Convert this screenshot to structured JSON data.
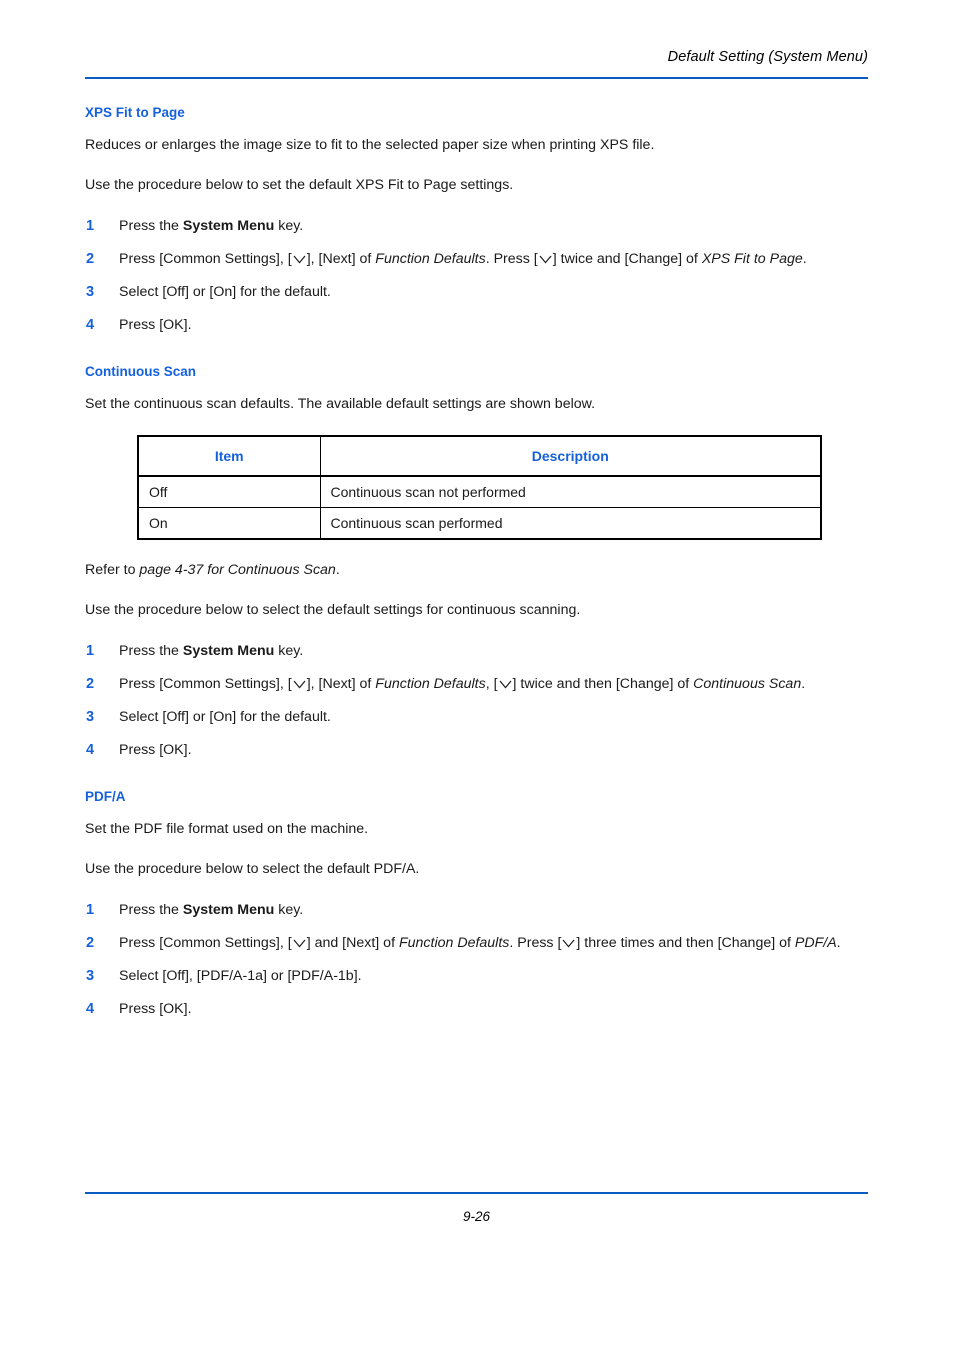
{
  "header": {
    "title": "Default Setting (System Menu)"
  },
  "footer": {
    "page_number": "9-26"
  },
  "colors": {
    "heading_blue": "#1560dd",
    "rule_blue": "#0b5cc0",
    "step_number_blue": "#1560dd",
    "table_header_blue": "#1560dd",
    "body_text": "#1a1a1a",
    "table_border": "#000000"
  },
  "sections": [
    {
      "heading": "XPS Fit to Page",
      "intro_1": "Reduces or enlarges the image size to fit to the selected paper size when printing XPS file.",
      "intro_2": "Use the procedure below to set the default XPS Fit to Page settings.",
      "steps": [
        {
          "num": "1",
          "parts": [
            {
              "t": "text",
              "v": "Press the "
            },
            {
              "t": "bold",
              "v": "System Menu"
            },
            {
              "t": "text",
              "v": " key."
            }
          ]
        },
        {
          "num": "2",
          "parts": [
            {
              "t": "text",
              "v": "Press [Common Settings], ["
            },
            {
              "t": "chevron",
              "v": "down-chevron"
            },
            {
              "t": "text",
              "v": "], [Next] of "
            },
            {
              "t": "italic",
              "v": "Function Defaults"
            },
            {
              "t": "text",
              "v": ". Press ["
            },
            {
              "t": "chevron",
              "v": "down-chevron"
            },
            {
              "t": "text",
              "v": "] twice and [Change] of "
            },
            {
              "t": "italic",
              "v": "XPS Fit to Page"
            },
            {
              "t": "text",
              "v": "."
            }
          ]
        },
        {
          "num": "3",
          "parts": [
            {
              "t": "text",
              "v": "Select [Off] or [On] for the default."
            }
          ]
        },
        {
          "num": "4",
          "parts": [
            {
              "t": "text",
              "v": "Press [OK]."
            }
          ]
        }
      ]
    },
    {
      "heading": "Continuous Scan",
      "intro_1": "Set the continuous scan defaults. The available default settings are shown below.",
      "table": {
        "columns": [
          "Item",
          "Description"
        ],
        "rows": [
          [
            "Off",
            "Continuous scan not performed"
          ],
          [
            "On",
            "Continuous scan performed"
          ]
        ]
      },
      "refer_to": [
        {
          "t": "text",
          "v": "Refer to "
        },
        {
          "t": "italic",
          "v": "page 4-37 for Continuous Scan"
        },
        {
          "t": "text",
          "v": "."
        }
      ],
      "intro_2": "Use the procedure below to select the default settings for continuous scanning.",
      "steps": [
        {
          "num": "1",
          "parts": [
            {
              "t": "text",
              "v": "Press the "
            },
            {
              "t": "bold",
              "v": "System Menu"
            },
            {
              "t": "text",
              "v": " key."
            }
          ]
        },
        {
          "num": "2",
          "parts": [
            {
              "t": "text",
              "v": "Press [Common Settings], ["
            },
            {
              "t": "chevron",
              "v": "down-chevron"
            },
            {
              "t": "text",
              "v": "], [Next] of "
            },
            {
              "t": "italic",
              "v": "Function Defaults"
            },
            {
              "t": "text",
              "v": ", ["
            },
            {
              "t": "chevron",
              "v": "down-chevron"
            },
            {
              "t": "text",
              "v": "] twice and then [Change] of "
            },
            {
              "t": "italic",
              "v": "Continuous Scan"
            },
            {
              "t": "text",
              "v": "."
            }
          ]
        },
        {
          "num": "3",
          "parts": [
            {
              "t": "text",
              "v": "Select [Off] or [On] for the default."
            }
          ]
        },
        {
          "num": "4",
          "parts": [
            {
              "t": "text",
              "v": "Press [OK]."
            }
          ]
        }
      ]
    },
    {
      "heading": "PDF/A",
      "intro_1": "Set the PDF file format used on the machine.",
      "intro_2": "Use the procedure below to select the default PDF/A.",
      "steps": [
        {
          "num": "1",
          "parts": [
            {
              "t": "text",
              "v": "Press the "
            },
            {
              "t": "bold",
              "v": "System Menu"
            },
            {
              "t": "text",
              "v": " key."
            }
          ]
        },
        {
          "num": "2",
          "parts": [
            {
              "t": "text",
              "v": "Press [Common Settings], ["
            },
            {
              "t": "chevron",
              "v": "down-chevron"
            },
            {
              "t": "text",
              "v": "] and [Next] of "
            },
            {
              "t": "italic",
              "v": "Function Defaults"
            },
            {
              "t": "text",
              "v": ". Press ["
            },
            {
              "t": "chevron",
              "v": "down-chevron"
            },
            {
              "t": "text",
              "v": "] three times and then [Change] of "
            },
            {
              "t": "italic",
              "v": "PDF/A"
            },
            {
              "t": "text",
              "v": "."
            }
          ]
        },
        {
          "num": "3",
          "parts": [
            {
              "t": "text",
              "v": "Select [Off], [PDF/A-1a] or [PDF/A-1b]."
            }
          ]
        },
        {
          "num": "4",
          "parts": [
            {
              "t": "text",
              "v": "Press [OK]."
            }
          ]
        }
      ]
    }
  ]
}
